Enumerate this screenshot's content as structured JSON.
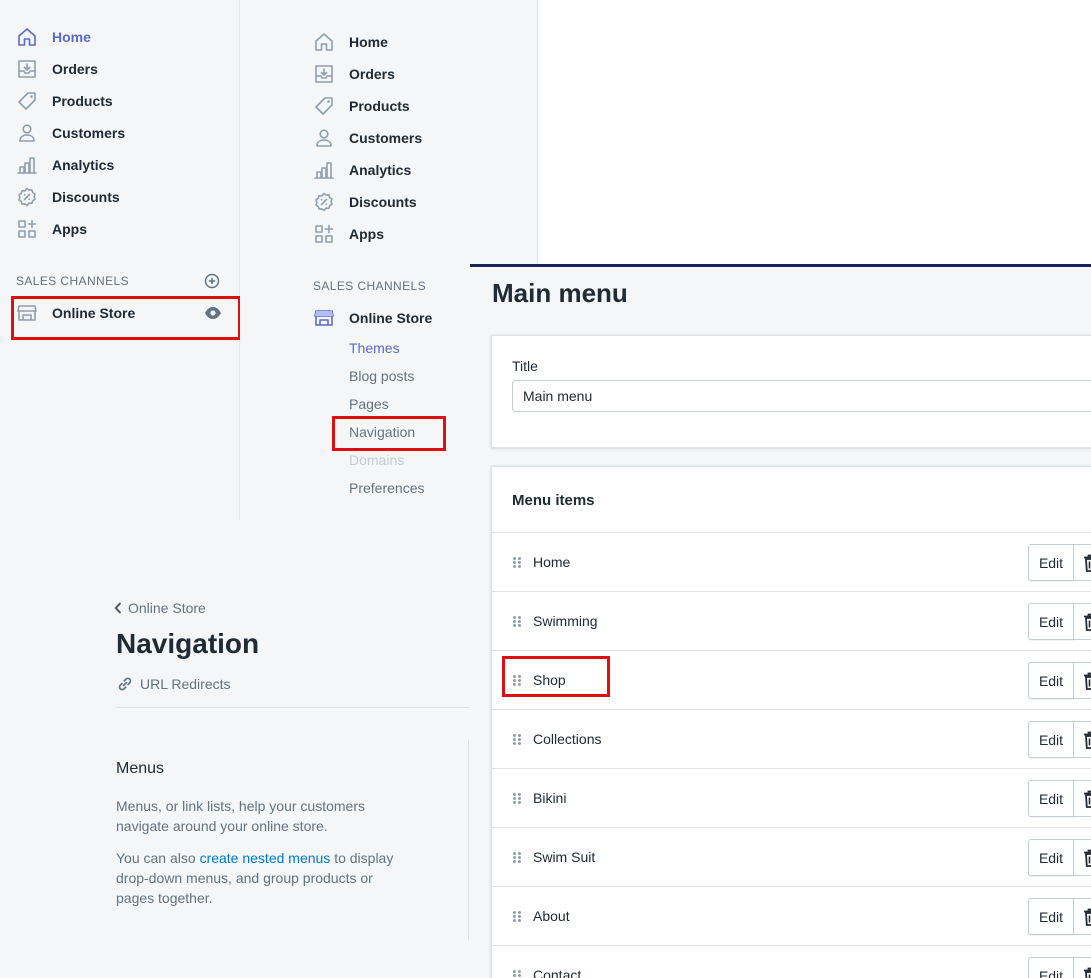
{
  "left_sidebar": {
    "items": [
      {
        "label": "Home",
        "icon": "home-icon",
        "active": true
      },
      {
        "label": "Orders",
        "icon": "orders-icon"
      },
      {
        "label": "Products",
        "icon": "tag-icon"
      },
      {
        "label": "Customers",
        "icon": "person-icon"
      },
      {
        "label": "Analytics",
        "icon": "bar-chart-icon"
      },
      {
        "label": "Discounts",
        "icon": "discount-icon"
      },
      {
        "label": "Apps",
        "icon": "apps-icon"
      }
    ],
    "sales_channels_title": "SALES CHANNELS",
    "online_store_label": "Online Store"
  },
  "mid_sidebar": {
    "items": [
      {
        "label": "Home",
        "icon": "home-icon"
      },
      {
        "label": "Orders",
        "icon": "orders-icon"
      },
      {
        "label": "Products",
        "icon": "tag-icon"
      },
      {
        "label": "Customers",
        "icon": "person-icon"
      },
      {
        "label": "Analytics",
        "icon": "bar-chart-icon"
      },
      {
        "label": "Discounts",
        "icon": "discount-icon"
      },
      {
        "label": "Apps",
        "icon": "apps-icon"
      }
    ],
    "sales_channels_title": "SALES CHANNELS",
    "online_store_label": "Online Store",
    "sub_items": [
      {
        "label": "Themes",
        "state": "active"
      },
      {
        "label": "Blog posts",
        "state": "normal"
      },
      {
        "label": "Pages",
        "state": "normal"
      },
      {
        "label": "Navigation",
        "state": "normal"
      },
      {
        "label": "Domains",
        "state": "disabled"
      },
      {
        "label": "Preferences",
        "state": "normal"
      }
    ]
  },
  "navigation_page": {
    "breadcrumb": "Online Store",
    "title": "Navigation",
    "url_redirects": "URL Redirects",
    "menus_heading": "Menus",
    "menus_description": "Menus, or link lists, help your customers navigate around your online store.",
    "nested_prefix": "You can also ",
    "nested_link": "create nested menus",
    "nested_suffix": " to display drop-down menus, and group products or pages together."
  },
  "main_menu_page": {
    "title": "Main menu",
    "title_field_label": "Title",
    "title_field_value": "Main menu",
    "menu_items_heading": "Menu items",
    "edit_label": "Edit",
    "menu_items": [
      "Home",
      "Swimming",
      "Shop",
      "Collections",
      "Bikini",
      "Swim Suit",
      "About",
      "Contact"
    ]
  },
  "colors": {
    "accent": "#5c6ac4",
    "highlight": "#e10e0e",
    "link": "#007ace",
    "page_top_bar": "#1c2260"
  }
}
